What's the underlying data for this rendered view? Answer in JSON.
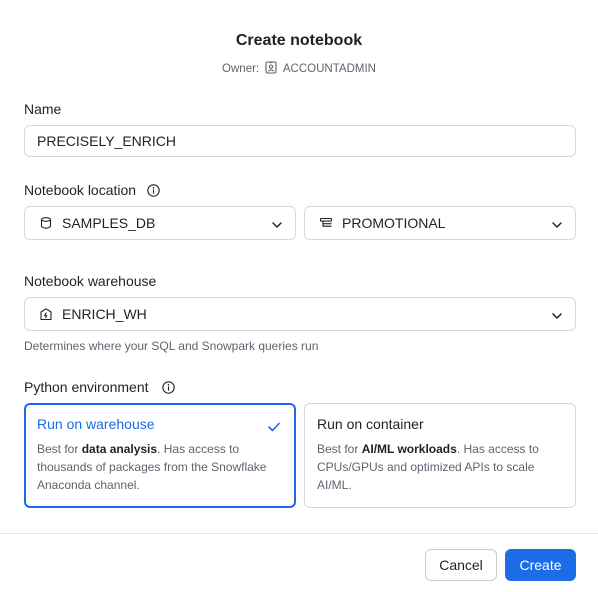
{
  "dialog": {
    "title": "Create notebook",
    "owner_label": "Owner:",
    "owner_value": "ACCOUNTADMIN"
  },
  "name": {
    "label": "Name",
    "value": "PRECISELY_ENRICH"
  },
  "location": {
    "label": "Notebook location",
    "database": "SAMPLES_DB",
    "schema": "PROMOTIONAL"
  },
  "warehouse": {
    "label": "Notebook warehouse",
    "value": "ENRICH_WH",
    "hint": "Determines where your SQL and Snowpark queries run"
  },
  "python_env": {
    "label": "Python environment",
    "options": [
      {
        "title": "Run on warehouse",
        "desc_prefix": "Best for ",
        "desc_bold": "data analysis",
        "desc_suffix": ". Has access to thousands of packages from the Snowflake Anaconda channel.",
        "selected": true
      },
      {
        "title": "Run on container",
        "desc_prefix": "Best for ",
        "desc_bold": "AI/ML workloads",
        "desc_suffix": ". Has access to CPUs/GPUs and optimized APIs to scale AI/ML.",
        "selected": false
      }
    ]
  },
  "footer": {
    "cancel_label": "Cancel",
    "create_label": "Create"
  },
  "colors": {
    "accent": "#1a6ce7",
    "border": "#d5d8de",
    "text": "#1e2127",
    "muted": "#5d6470"
  },
  "icons": {
    "owner": "user-badge-icon",
    "info": "info-icon",
    "database": "database-icon",
    "schema": "schema-icon",
    "warehouse": "warehouse-icon",
    "chevron": "chevron-down-icon",
    "check": "check-icon"
  }
}
